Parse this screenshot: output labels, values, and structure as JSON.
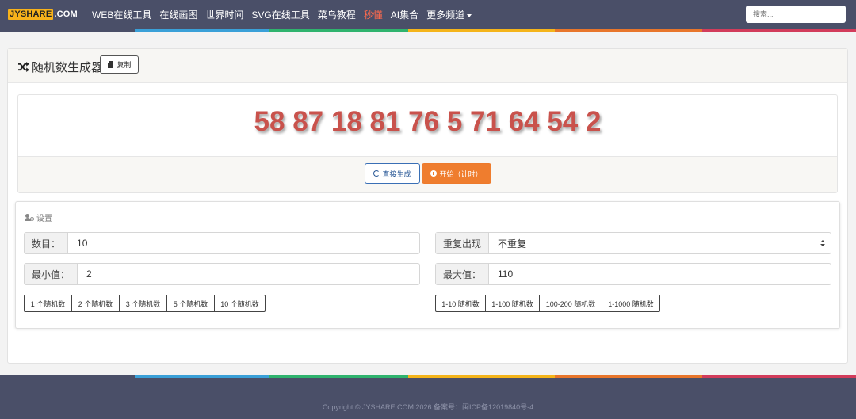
{
  "header": {
    "logo_main": "JYSHARE",
    "logo_suffix": ".COM",
    "nav": [
      {
        "label": "WEB在线工具",
        "hot": false
      },
      {
        "label": "在线画图",
        "hot": false
      },
      {
        "label": "世界时间",
        "hot": false
      },
      {
        "label": "SVG在线工具",
        "hot": false
      },
      {
        "label": "菜鸟教程",
        "hot": false
      },
      {
        "label": "秒懂",
        "hot": true
      },
      {
        "label": "AI集合",
        "hot": false
      },
      {
        "label": "更多频道",
        "hot": false
      }
    ],
    "search_placeholder": "搜索..."
  },
  "tool": {
    "title": "随机数生成器",
    "copy_label": "复制",
    "result": "58 87 18 81 76 5 71 64 54 2",
    "regen_label": "直接生成",
    "start_label": "开始（计时）"
  },
  "settings": {
    "title": "设置",
    "count_label": "数目：",
    "count_value": "10",
    "repeat_label": "重复出现",
    "repeat_value": "不重复",
    "min_label": "最小值：",
    "min_value": "2",
    "max_label": "最大值：",
    "max_value": "110",
    "count_presets": [
      "1 个随机数",
      "2 个随机数",
      "3 个随机数",
      "5 个随机数",
      "10 个随机数"
    ],
    "range_presets": [
      "1-10 随机数",
      "1-100 随机数",
      "100-200 随机数",
      "1-1000 随机数"
    ]
  },
  "footer": {
    "copyright": "Copyright © JYSHARE.COM 2026 备案号：闽ICP备12019840号-4"
  },
  "colors": {
    "nav_bg": "#4a4f68",
    "accent_orange": "#ef7d2e",
    "result_red": "#c9524c",
    "hot_link": "#ff6a4d",
    "logo_yellow": "#f7b21b"
  }
}
